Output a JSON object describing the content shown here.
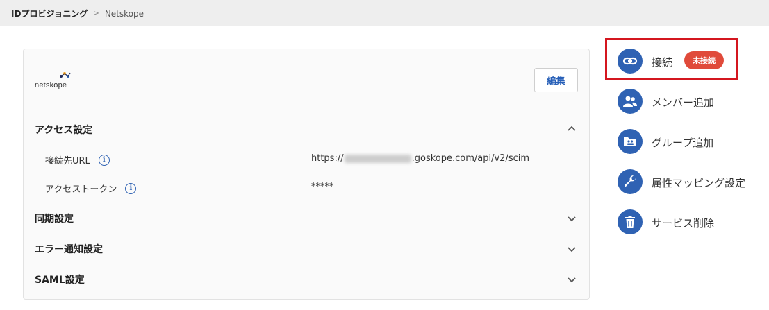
{
  "breadcrumb": {
    "root": "IDプロビジョニング",
    "separator": ">",
    "current": "Netskope"
  },
  "card": {
    "logo_text": "netskope",
    "edit_label": "編集",
    "sections": [
      {
        "title": "アクセス設定",
        "expanded": true
      },
      {
        "title": "同期設定",
        "expanded": false
      },
      {
        "title": "エラー通知設定",
        "expanded": false
      },
      {
        "title": "SAML設定",
        "expanded": false
      }
    ],
    "access": {
      "url_label": "接続先URL",
      "url_prefix": "https://",
      "url_suffix": ".goskope.com/api/v2/scim",
      "token_label": "アクセストークン",
      "token_value": "*****"
    }
  },
  "sidebar": {
    "connect": {
      "label": "接続",
      "badge": "未接続",
      "icon": "link-icon"
    },
    "add_member": {
      "label": "メンバー追加",
      "icon": "people-icon"
    },
    "add_group": {
      "label": "グループ追加",
      "icon": "group-folder-icon"
    },
    "attr_mapping": {
      "label": "属性マッピング設定",
      "icon": "wrench-icon"
    },
    "delete_service": {
      "label": "サービス削除",
      "icon": "trash-icon"
    }
  },
  "colors": {
    "accent": "#2f62b3",
    "badge": "#e04a3a",
    "highlight": "#d4161f"
  }
}
